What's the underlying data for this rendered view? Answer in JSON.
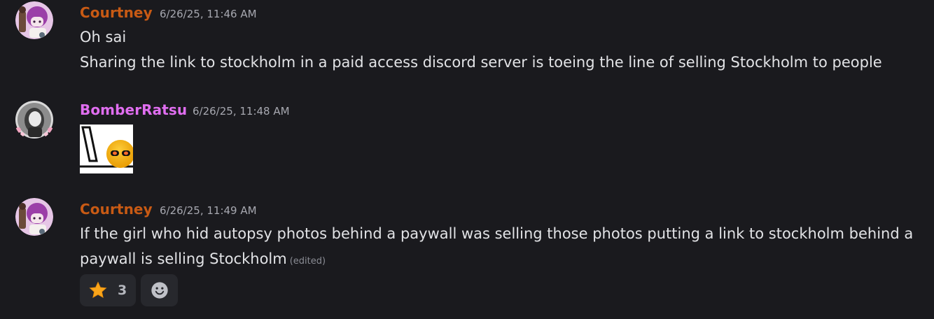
{
  "messages": [
    {
      "username": "Courtney",
      "timestamp": "6/26/25, 11:46 AM",
      "lines": [
        "Oh sai",
        "Sharing the link to stockholm in a paid access discord server is toeing the line of selling Stockholm to people"
      ]
    },
    {
      "username": "BomberRatsu",
      "timestamp": "6/26/25, 11:48 AM",
      "attachment": "sleepy-emoji-sticker"
    },
    {
      "username": "Courtney",
      "timestamp": "6/26/25, 11:49 AM",
      "lines": [
        "If the girl who hid autopsy photos behind a paywall was selling those photos putting a link to stockholm behind a",
        "paywall is selling Stockholm"
      ],
      "edited_label": "(edited)",
      "reactions": [
        {
          "icon": "star-emoji",
          "count": "3"
        },
        {
          "icon": "add-reaction-icon"
        }
      ]
    }
  ],
  "colors": {
    "background": "#1a1a1e",
    "courtney_name": "#c85a14",
    "bomberratsu_name": "#e06ef0",
    "timestamp": "#a7a8b0",
    "reaction_bg": "#27282d"
  }
}
